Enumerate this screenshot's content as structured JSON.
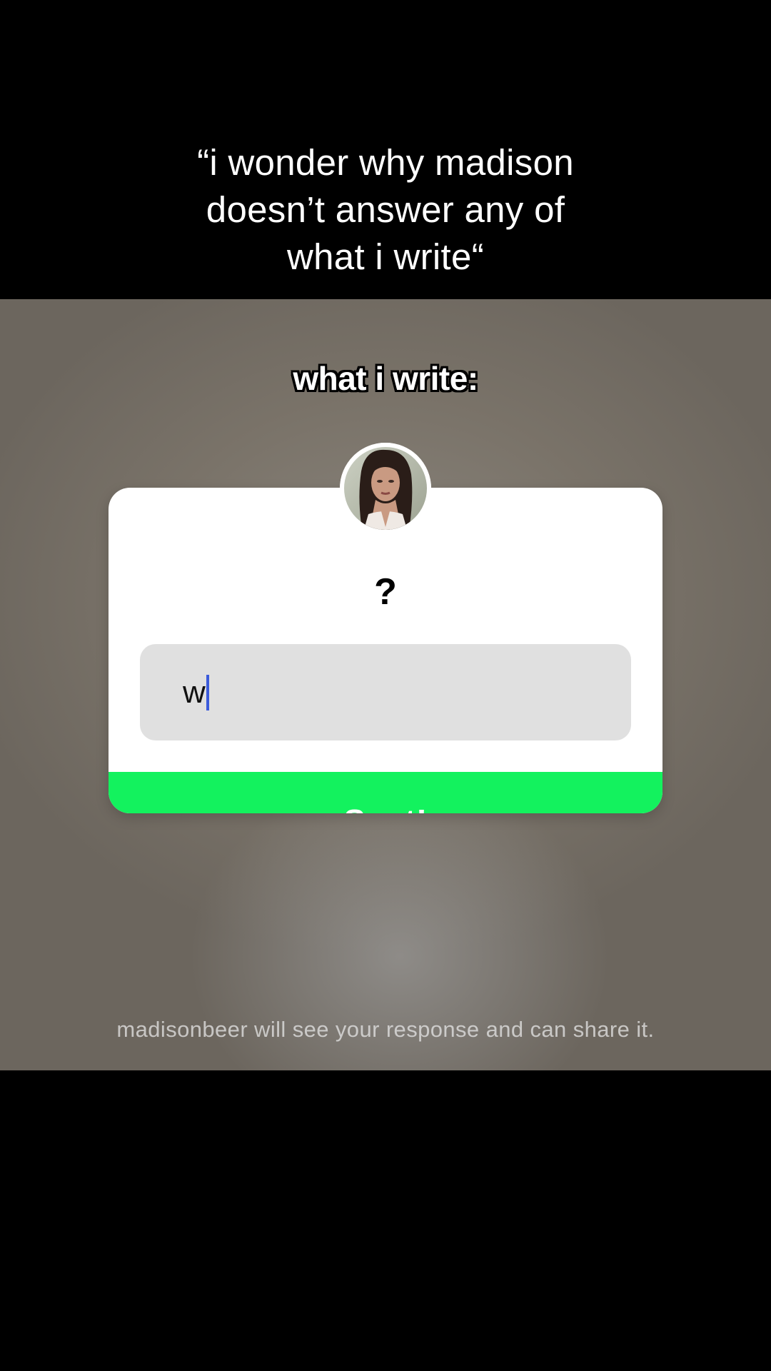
{
  "caption": {
    "lines": [
      "“i wonder why madison",
      "doesn’t answer any of",
      "what i write“"
    ]
  },
  "overlay": {
    "title": "what i write:"
  },
  "question_box": {
    "question": "?",
    "answer_value": "w",
    "button_label": "Sent!",
    "button_color": "#13f25e"
  },
  "disclaimer": "madisonbeer will see your response and can share it.",
  "icons": {
    "avatar": "profile-photo"
  }
}
